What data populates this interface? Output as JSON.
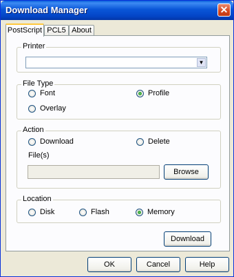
{
  "window": {
    "title": "Download Manager"
  },
  "tabs": [
    "PostScript",
    "PCL5",
    "About"
  ],
  "printer": {
    "label": "Printer",
    "selected": ""
  },
  "file_type": {
    "label": "File Type",
    "options": [
      "Font",
      "Profile",
      "Overlay"
    ],
    "selected": "Profile"
  },
  "action": {
    "label": "Action",
    "options": [
      "Download",
      "Delete"
    ],
    "selected": "",
    "files_label": "File(s)",
    "files_value": "",
    "browse": "Browse"
  },
  "location": {
    "label": "Location",
    "options": [
      "Disk",
      "Flash",
      "Memory"
    ],
    "selected": "Memory"
  },
  "download_button": "Download",
  "footer": {
    "ok": "OK",
    "cancel": "Cancel",
    "help": "Help"
  },
  "icons": {
    "close": "close-icon",
    "dropdown": "chevron-down-icon"
  }
}
